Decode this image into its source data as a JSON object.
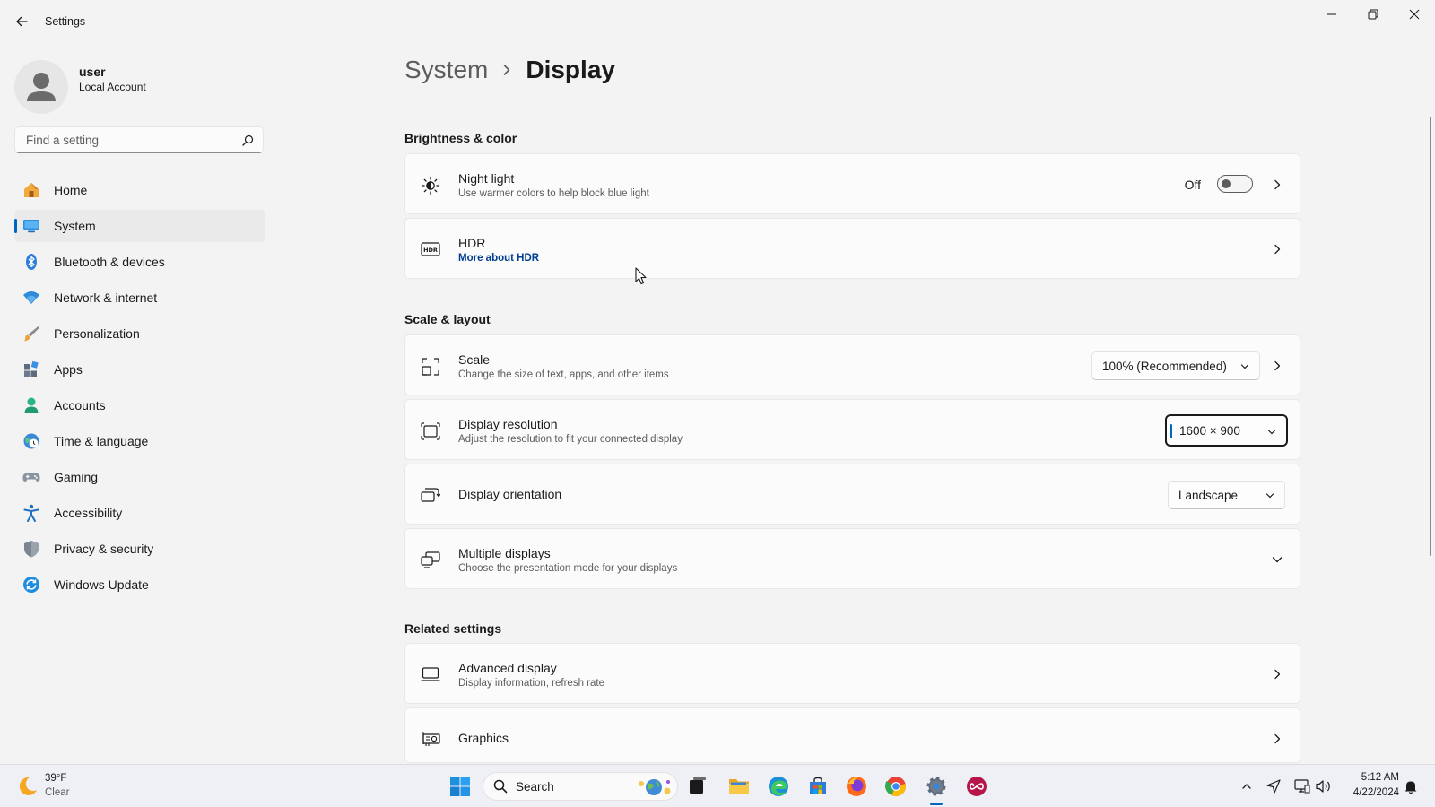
{
  "window": {
    "title": "Settings"
  },
  "profile": {
    "name": "user",
    "account_type": "Local Account"
  },
  "search": {
    "placeholder": "Find a setting"
  },
  "nav": {
    "items": [
      {
        "label": "Home",
        "icon": "home-icon",
        "active": false
      },
      {
        "label": "System",
        "icon": "system-icon",
        "active": true
      },
      {
        "label": "Bluetooth & devices",
        "icon": "bluetooth-icon",
        "active": false
      },
      {
        "label": "Network & internet",
        "icon": "wifi-icon",
        "active": false
      },
      {
        "label": "Personalization",
        "icon": "brush-icon",
        "active": false
      },
      {
        "label": "Apps",
        "icon": "apps-icon",
        "active": false
      },
      {
        "label": "Accounts",
        "icon": "accounts-icon",
        "active": false
      },
      {
        "label": "Time & language",
        "icon": "clock-globe-icon",
        "active": false
      },
      {
        "label": "Gaming",
        "icon": "gamepad-icon",
        "active": false
      },
      {
        "label": "Accessibility",
        "icon": "accessibility-icon",
        "active": false
      },
      {
        "label": "Privacy & security",
        "icon": "shield-icon",
        "active": false
      },
      {
        "label": "Windows Update",
        "icon": "update-icon",
        "active": false
      }
    ]
  },
  "breadcrumb": {
    "parent": "System",
    "current": "Display"
  },
  "sections": {
    "brightness": "Brightness & color",
    "scale_layout": "Scale & layout",
    "related": "Related settings"
  },
  "cards": {
    "night_light": {
      "title": "Night light",
      "subtitle": "Use warmer colors to help block blue light",
      "toggle_state": "Off"
    },
    "hdr": {
      "title": "HDR",
      "link": "More about HDR"
    },
    "scale": {
      "title": "Scale",
      "subtitle": "Change the size of text, apps, and other items",
      "value": "100% (Recommended)"
    },
    "resolution": {
      "title": "Display resolution",
      "subtitle": "Adjust the resolution to fit your connected display",
      "value": "1600 × 900"
    },
    "orientation": {
      "title": "Display orientation",
      "value": "Landscape"
    },
    "multiple": {
      "title": "Multiple displays",
      "subtitle": "Choose the presentation mode for your displays"
    },
    "advanced": {
      "title": "Advanced display",
      "subtitle": "Display information, refresh rate"
    },
    "graphics": {
      "title": "Graphics"
    }
  },
  "taskbar": {
    "weather_temp": "39°F",
    "weather_condition": "Clear",
    "search_label": "Search",
    "time": "5:12 AM",
    "date": "4/22/2024"
  },
  "colors": {
    "accent": "#0067c0",
    "link": "#003e92",
    "background": "#f3f3f3",
    "card": "#fbfbfb"
  }
}
